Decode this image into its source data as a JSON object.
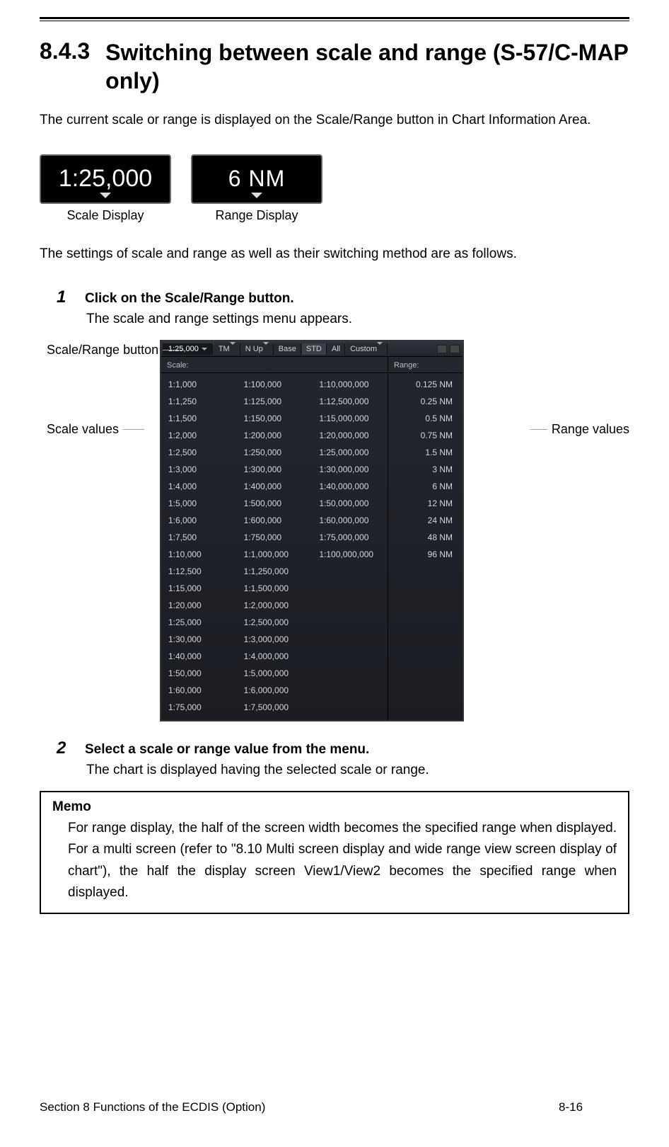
{
  "heading": {
    "number": "8.4.3",
    "title": "Switching between scale and range (S-57/C-MAP only)"
  },
  "intro": "The current scale or range is displayed on the Scale/Range button in Chart Information Area.",
  "displays": {
    "scale_value": "1:25,000",
    "range_value": "6 NM",
    "scale_caption": "Scale Display",
    "range_caption": "Range Display"
  },
  "lead2": "The settings of scale and range as well as their switching method are as follows.",
  "steps": {
    "s1": {
      "num": "1",
      "title": "Click on the Scale/Range button.",
      "desc": "The scale and range settings menu appears."
    },
    "s2": {
      "num": "2",
      "title": "Select a scale or range value from the menu.",
      "desc": "The chart is displayed having the selected scale or range."
    }
  },
  "callouts": {
    "scale_range_button": "Scale/Range button",
    "scale_values": "Scale values",
    "range_values": "Range values"
  },
  "menu": {
    "current": "1:25,000",
    "tm": "TM",
    "nup": "N Up",
    "base": "Base",
    "std": "STD",
    "all": "All",
    "custom": "Custom",
    "scale_header": "Scale:",
    "range_header": "Range:",
    "scales_col1": [
      "1:1,000",
      "1:1,250",
      "1:1,500",
      "1:2,000",
      "1:2,500",
      "1:3,000",
      "1:4,000",
      "1:5,000",
      "1:6,000",
      "1:7,500",
      "1:10,000",
      "1:12,500",
      "1:15,000",
      "1:20,000",
      "1:25,000",
      "1:30,000",
      "1:40,000",
      "1:50,000",
      "1:60,000",
      "1:75,000"
    ],
    "scales_col2": [
      "1:100,000",
      "1:125,000",
      "1:150,000",
      "1:200,000",
      "1:250,000",
      "1:300,000",
      "1:400,000",
      "1:500,000",
      "1:600,000",
      "1:750,000",
      "1:1,000,000",
      "1:1,250,000",
      "1:1,500,000",
      "1:2,000,000",
      "1:2,500,000",
      "1:3,000,000",
      "1:4,000,000",
      "1:5,000,000",
      "1:6,000,000",
      "1:7,500,000"
    ],
    "scales_col3": [
      "1:10,000,000",
      "1:12,500,000",
      "1:15,000,000",
      "1:20,000,000",
      "1:25,000,000",
      "1:30,000,000",
      "1:40,000,000",
      "1:50,000,000",
      "1:60,000,000",
      "1:75,000,000",
      "1:100,000,000"
    ],
    "ranges": [
      "0.125 NM",
      "0.25 NM",
      "0.5 NM",
      "0.75 NM",
      "1.5 NM",
      "3 NM",
      "6 NM",
      "12 NM",
      "24 NM",
      "48 NM",
      "96 NM"
    ]
  },
  "memo": {
    "title": "Memo",
    "body": "For range display, the half of the screen width becomes the specified range when displayed. For a multi screen (refer to \"8.10 Multi screen display and wide range view screen display of chart\"), the half the display screen View1/View2 becomes the specified range when displayed."
  },
  "footer": {
    "left": "Section 8  Functions of the ECDIS (Option)",
    "center": "8-16"
  }
}
